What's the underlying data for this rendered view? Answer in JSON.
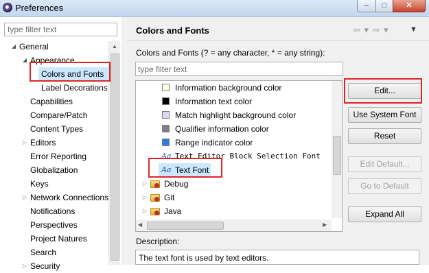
{
  "window": {
    "title": "Preferences",
    "controls": {
      "minimize": "–",
      "maximize": "□",
      "close": "✕"
    }
  },
  "left": {
    "filter_placeholder": "type filter text",
    "tree": [
      {
        "label": "General",
        "expanded": true
      },
      {
        "label": "Appearance",
        "expanded": true
      },
      {
        "label": "Colors and Fonts",
        "selected": true
      },
      {
        "label": "Label Decorations"
      },
      {
        "label": "Capabilities"
      },
      {
        "label": "Compare/Patch"
      },
      {
        "label": "Content Types"
      },
      {
        "label": "Editors",
        "collapsed": true
      },
      {
        "label": "Error Reporting"
      },
      {
        "label": "Globalization"
      },
      {
        "label": "Keys"
      },
      {
        "label": "Network Connections",
        "collapsed": true
      },
      {
        "label": "Notifications"
      },
      {
        "label": "Perspectives"
      },
      {
        "label": "Project Natures"
      },
      {
        "label": "Search"
      },
      {
        "label": "Security"
      }
    ]
  },
  "header": {
    "title": "Colors and Fonts",
    "nav_icons": "⇦ ▾ ⇨ ▾",
    "menu_icon": "▼"
  },
  "main": {
    "section_label": "Colors and Fonts (? = any character, * = any string):",
    "filter_placeholder": "type filter text",
    "tree": [
      {
        "label": "Information background color",
        "icon": "color-swatch",
        "color": "#fffde0"
      },
      {
        "label": "Information text color",
        "icon": "color-swatch",
        "color": "#000000"
      },
      {
        "label": "Match highlight background color",
        "icon": "color-swatch",
        "color": "#dcd8f4"
      },
      {
        "label": "Qualifier information color",
        "icon": "color-swatch",
        "color": "#808080"
      },
      {
        "label": "Range indicator color",
        "icon": "color-swatch",
        "color": "#2b7de0"
      },
      {
        "label": "Text Editor Block Selection Font",
        "icon": "font-icon"
      },
      {
        "label": "Text Font",
        "icon": "font-icon",
        "selected": true
      },
      {
        "label": "Debug",
        "icon": "folder-icon"
      },
      {
        "label": "Git",
        "icon": "folder-icon"
      },
      {
        "label": "Java",
        "icon": "folder-icon"
      }
    ],
    "font_icon_glyph": "Aa",
    "buttons": {
      "edit": "Edit...",
      "use_system_font": "Use System Font",
      "reset": "Reset",
      "edit_default": "Edit Default...",
      "go_to_default": "Go to Default",
      "expand_all": "Expand All"
    },
    "description_label": "Description:",
    "description_text": "The text font is used by text editors."
  },
  "colors": {
    "highlight": "#e02424",
    "selection": "#cce8ff"
  }
}
